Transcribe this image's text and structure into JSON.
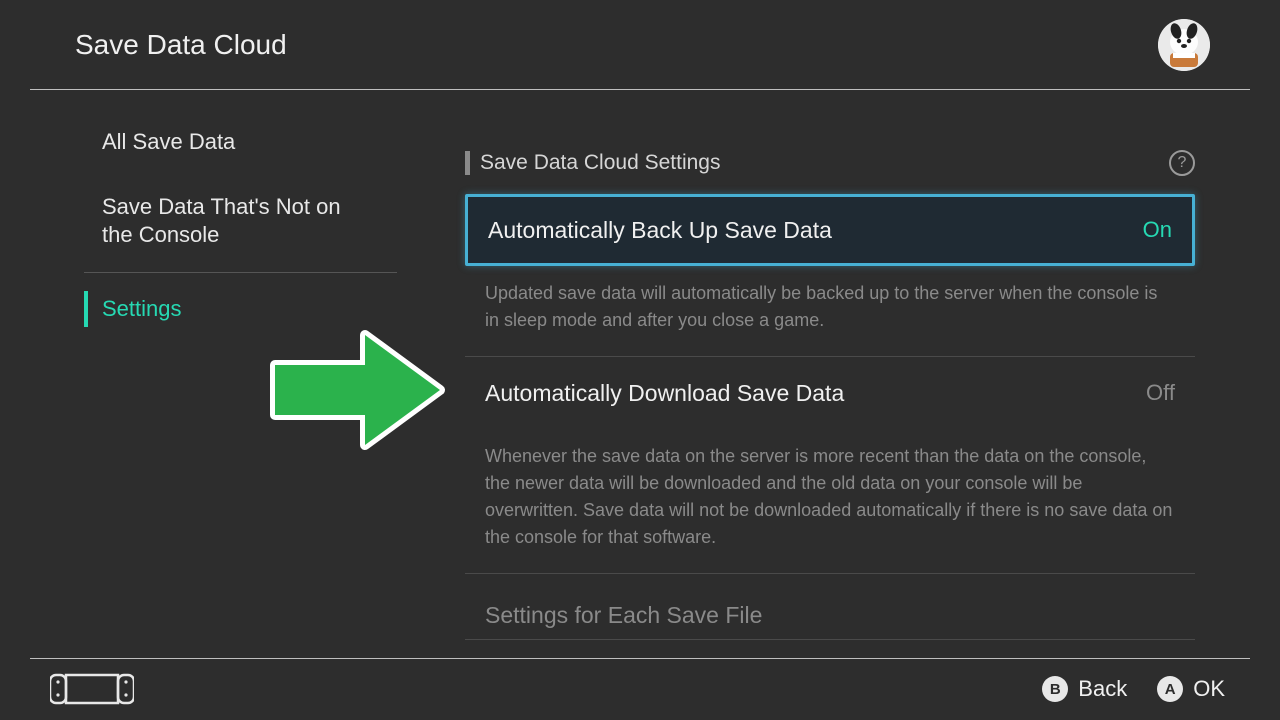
{
  "header": {
    "title": "Save Data Cloud"
  },
  "sidebar": {
    "items": [
      {
        "label": "All Save Data"
      },
      {
        "label": "Save Data That's Not on the Console"
      },
      {
        "label": "Settings"
      }
    ]
  },
  "content": {
    "section_title": "Save Data Cloud Settings",
    "settings": [
      {
        "label": "Automatically Back Up Save Data",
        "value": "On",
        "description": "Updated save data will automatically be backed up to the server when the console is in sleep mode and after you close a game."
      },
      {
        "label": "Automatically Download Save Data",
        "value": "Off",
        "description": "Whenever the save data on the server is more recent than the data on the console, the newer data will be downloaded and the old data on your console will be overwritten. Save data will not be downloaded automatically if there is no save data on the console for that software."
      }
    ],
    "subsection_title": "Settings for Each Save File"
  },
  "footer": {
    "back": {
      "glyph": "B",
      "label": "Back"
    },
    "ok": {
      "glyph": "A",
      "label": "OK"
    }
  }
}
